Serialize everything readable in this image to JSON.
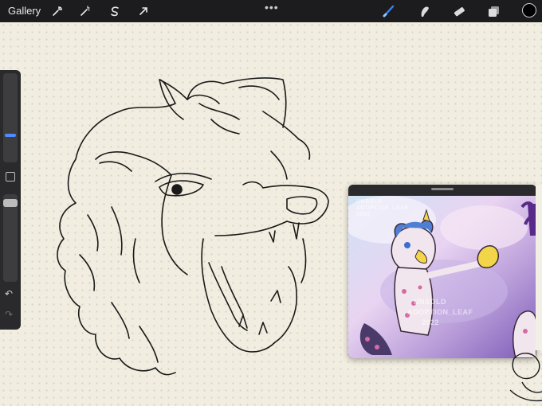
{
  "topbar": {
    "gallery_label": "Gallery",
    "left_icons": [
      "wrench-icon",
      "magic-wand-icon",
      "selection-icon",
      "transform-arrow-icon"
    ],
    "right_icons": [
      "brush-icon",
      "smudge-icon",
      "eraser-icon",
      "layers-icon"
    ],
    "more": "•••",
    "current_color": "#000000"
  },
  "sidebar": {
    "undo": "↶",
    "redo": "↷",
    "accent": "#4f8cff",
    "brush_size_level": 0.3,
    "opacity_level": 1.0
  },
  "reference": {
    "watermark_top": "UNSOLD\nADOPTION_LEAF\n2022",
    "watermark_mid": "UNSOLD",
    "watermark_line2": "ADOPTION_LEAF",
    "watermark_year": "2022"
  }
}
